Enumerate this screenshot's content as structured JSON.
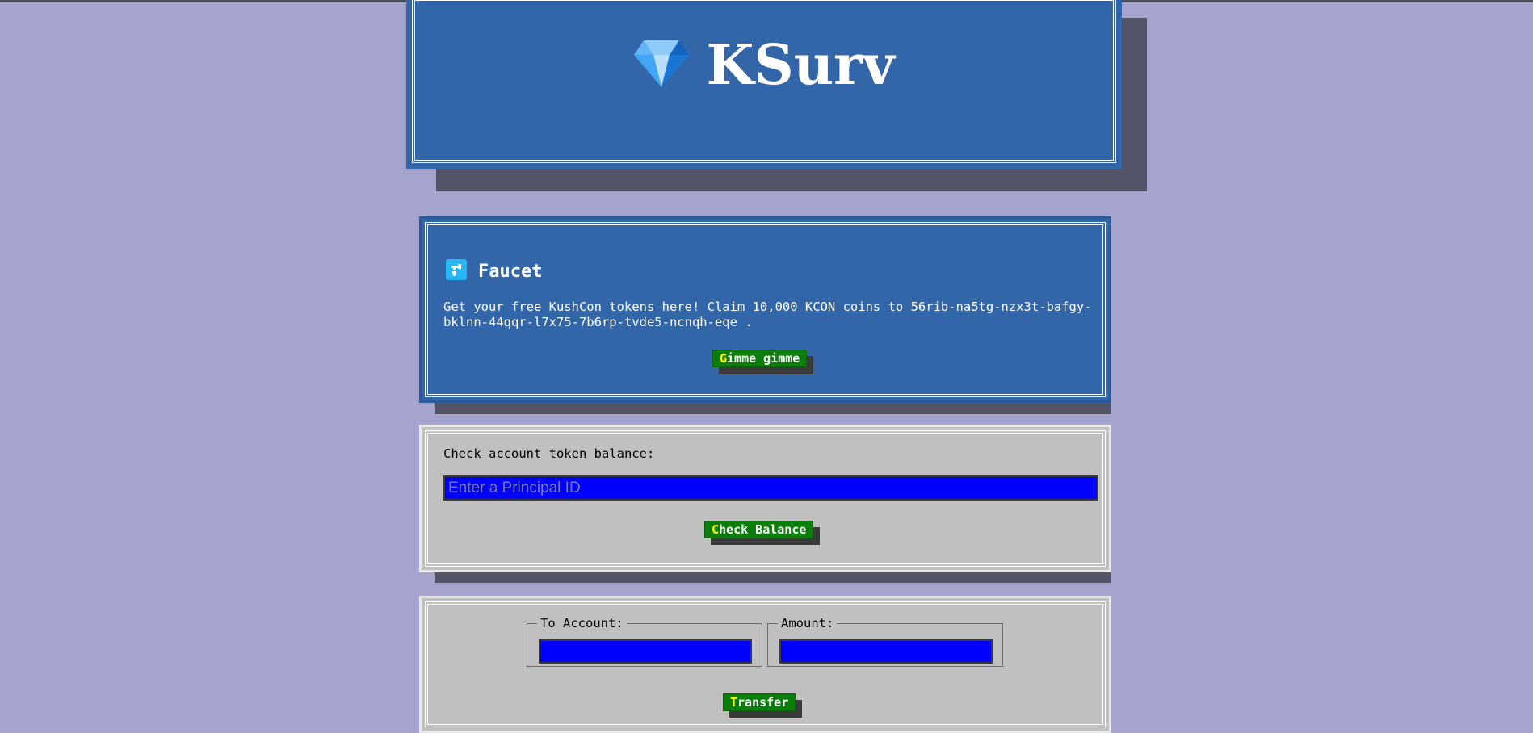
{
  "header": {
    "app_title": "KSurv",
    "logo_icon": "gem-icon"
  },
  "faucet": {
    "icon": "faucet-icon",
    "title": "Faucet",
    "description": "Get your free KushCon tokens here! Claim 10,000 KCON coins to 56rib-na5tg-nzx3t-bafgy-bklnn-44qqr-l7x75-7b6rp-tvde5-ncnqh-eqe .",
    "button_hotkey": "G",
    "button_rest": "imme gimme"
  },
  "balance": {
    "label": "Check account token balance:",
    "input_placeholder": "Enter a Principal ID",
    "input_value": "",
    "button_hotkey": "C",
    "button_rest": "heck Balance"
  },
  "transfer": {
    "to_account_legend": "To Account:",
    "amount_legend": "Amount:",
    "to_account_value": "",
    "amount_value": "",
    "button_hotkey": "T",
    "button_rest": "ransfer"
  },
  "colors": {
    "page_background": "#a4a4ce",
    "panel_blue": "#3366a8",
    "panel_gray": "#c0c0c0",
    "button_green": "#0a7d0a",
    "input_blue": "#0000ff",
    "hotkey_yellow": "#ffff00"
  }
}
